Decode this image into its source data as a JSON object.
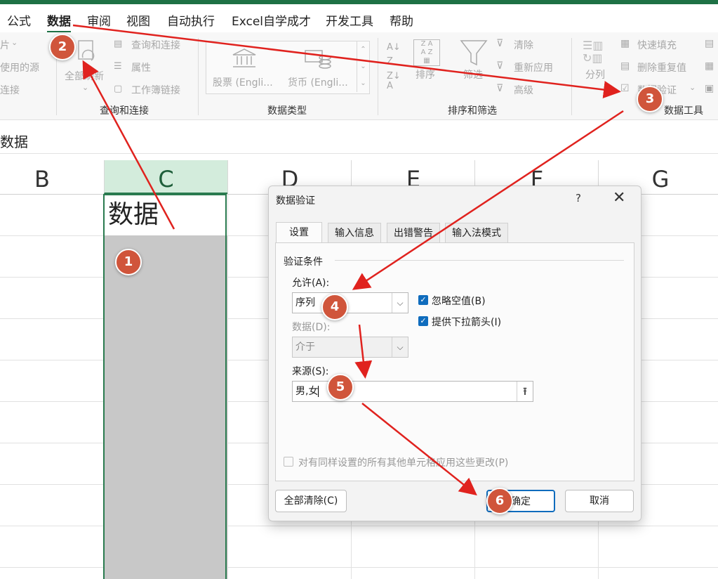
{
  "menu": {
    "tabs": [
      "公式",
      "数据",
      "审阅",
      "视图",
      "自动执行",
      "Excel自学成才",
      "开发工具",
      "帮助"
    ],
    "active": "数据"
  },
  "ribbon": {
    "get_data": {
      "item1": "片",
      "item2": "使用的源",
      "item3": "连接"
    },
    "queries": {
      "refresh_all": "全部刷新",
      "queries_connections": "查询和连接",
      "properties": "属性",
      "workbook_links": "工作簿链接",
      "label": "查询和连接"
    },
    "data_types": {
      "stocks": "股票 (Engli...",
      "currencies": "货币 (Engli...",
      "label": "数据类型"
    },
    "sort_filter": {
      "sort": "排序",
      "filter": "筛选",
      "clear": "清除",
      "reapply": "重新应用",
      "advanced": "高级",
      "label": "排序和筛选"
    },
    "data_tools": {
      "text_to_columns": "分列",
      "flash_fill": "快速填充",
      "remove_duplicates": "删除重复值",
      "data_validation": "数据验证",
      "label": "数据工具"
    }
  },
  "formula_bar": {
    "content": "数据"
  },
  "columns": [
    "B",
    "C",
    "D",
    "E",
    "F",
    "G"
  ],
  "sheet": {
    "c1": "数据"
  },
  "dialog": {
    "title": "数据验证",
    "help": "?",
    "close": "✕",
    "tabs": [
      "设置",
      "输入信息",
      "出错警告",
      "输入法模式"
    ],
    "section_label": "验证条件",
    "allow_label": "允许(A):",
    "allow_value": "序列",
    "ignore_blank": "忽略空值(B)",
    "dropdown": "提供下拉箭头(I)",
    "data_label": "数据(D):",
    "data_value": "介于",
    "source_label": "来源(S):",
    "source_value": "男,女",
    "apply_all": "对有同样设置的所有其他单元格应用这些更改(P)",
    "clear_all": "全部清除(C)",
    "ok": "确定",
    "cancel": "取消"
  },
  "badges": [
    "1",
    "2",
    "3",
    "4",
    "5",
    "6"
  ],
  "colors": {
    "accent_green": "#1e7145",
    "annotation": "#d0553b",
    "arrow": "#e0221e",
    "checkbox_blue": "#0f6cbd"
  }
}
